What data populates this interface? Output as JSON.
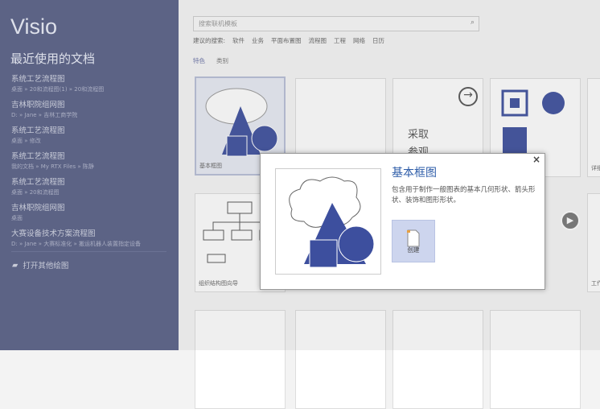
{
  "sidebar": {
    "app_title": "Visio",
    "recent_heading": "最近使用的文档",
    "recent": [
      {
        "title": "系统工艺流程图",
        "path": "桌面 » 20和流程图(1) » 20和流程图"
      },
      {
        "title": "吉林职院组网图",
        "path": "D: » Jane » 吉林工商学院"
      },
      {
        "title": "系统工艺流程图",
        "path": "桌面 » 修改"
      },
      {
        "title": "系统工艺流程图",
        "path": "我的文档 » My RTX Files » 陈静"
      },
      {
        "title": "系统工艺流程图",
        "path": "桌面 » 20和流程图"
      },
      {
        "title": "吉林职院组网图",
        "path": "桌面"
      },
      {
        "title": "大赛设备技术方案流程图",
        "path": "D: » Jane » 大赛标准化 » 搬运机器人装置指定设备"
      }
    ],
    "open_other": "打开其他绘图"
  },
  "main": {
    "search_placeholder": "搜索联机模板",
    "suggest_label": "建议的搜索:",
    "suggestions": [
      "软件",
      "业务",
      "平面布置图",
      "流程图",
      "工程",
      "网络",
      "日历"
    ],
    "tabs": [
      "特色",
      "类别"
    ],
    "tiles": [
      {
        "label": "基本框图"
      },
      {
        "label": "采取"
      },
      {
        "label": "参观"
      },
      {
        "label": "组织结构图向导"
      },
      {
        "label": "详细"
      },
      {
        "label": "工作"
      }
    ]
  },
  "dialog": {
    "title": "基本框图",
    "description": "包含用于制作一般图表的基本几何形状、箭头形状、装饰和图形形状。",
    "create_label": "创建",
    "close": "×"
  },
  "colors": {
    "sidebar": "#5c6385",
    "accent": "#2d5ca8",
    "shape": "#3d4f9e"
  }
}
